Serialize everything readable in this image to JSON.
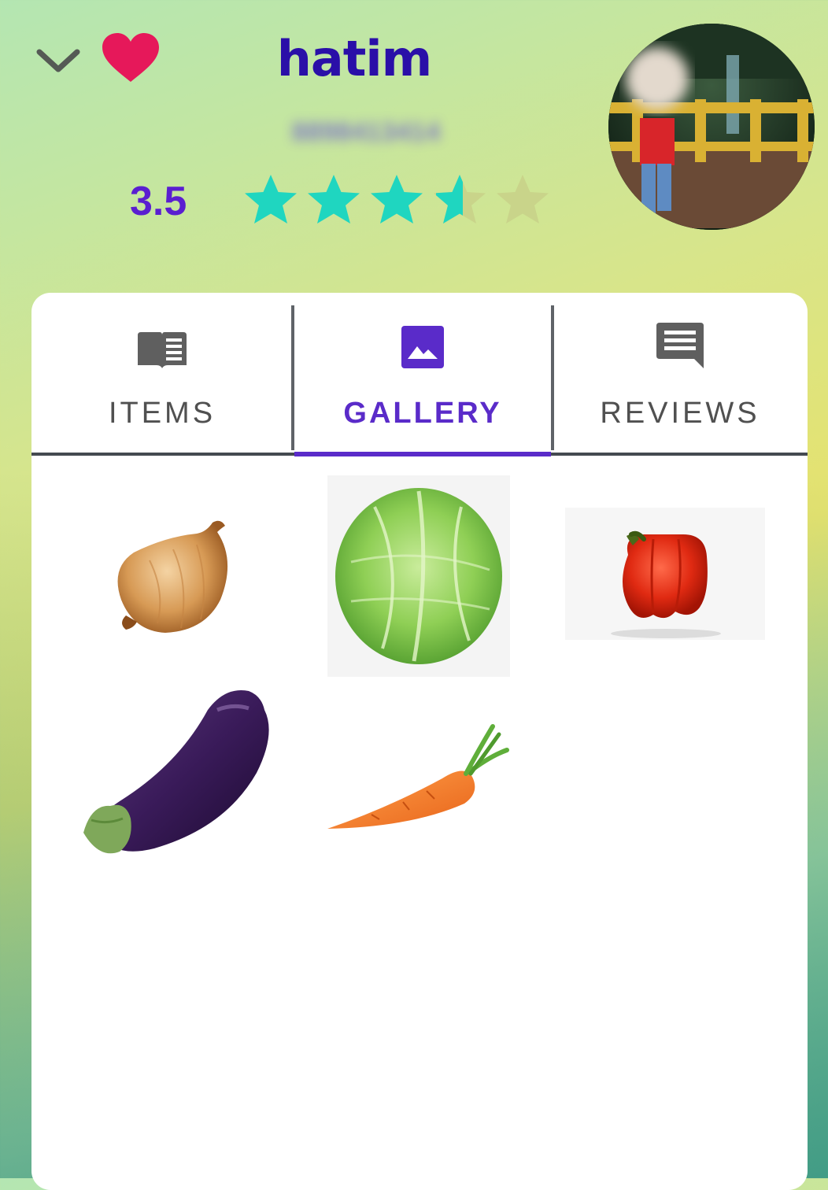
{
  "header": {
    "name": "hatim",
    "phone": "8898413414",
    "rating": "3.5",
    "rating_value": 3.5,
    "rating_max": 5
  },
  "icons": {
    "collapse": "chevron-down-icon",
    "favorite": "heart-icon"
  },
  "colors": {
    "name": "#2a0fa8",
    "rating": "#5a1ed0",
    "star_filled": "#1fd6c0",
    "star_empty": "#c9d48a",
    "heart": "#e6185a",
    "tab_active": "#5a2bc9",
    "tab_inactive": "#505050"
  },
  "tabs": [
    {
      "label": "ITEMS",
      "icon": "book-icon",
      "active": false
    },
    {
      "label": "GALLERY",
      "icon": "image-icon",
      "active": true
    },
    {
      "label": "REVIEWS",
      "icon": "comment-icon",
      "active": false
    }
  ],
  "gallery": [
    {
      "name": "onion"
    },
    {
      "name": "cabbage"
    },
    {
      "name": "red-bell-pepper"
    },
    {
      "name": "eggplant"
    },
    {
      "name": "carrot"
    }
  ]
}
